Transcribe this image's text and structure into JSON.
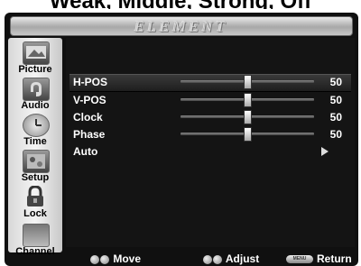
{
  "caption": "Weak, Middle, Strong, Off",
  "brand": "ELEMENT",
  "sidebar": {
    "items": [
      {
        "label": "Picture",
        "icon": "picture-icon",
        "selected": true
      },
      {
        "label": "Audio",
        "icon": "audio-icon",
        "selected": false
      },
      {
        "label": "Time",
        "icon": "time-icon",
        "selected": false
      },
      {
        "label": "Setup",
        "icon": "setup-icon",
        "selected": false
      },
      {
        "label": "Lock",
        "icon": "lock-icon",
        "selected": false
      },
      {
        "label": "Channel",
        "icon": "channel-icon",
        "selected": false
      }
    ]
  },
  "menu": {
    "rows": [
      {
        "label": "H-POS",
        "value": "50",
        "level": 0.5,
        "selected": true
      },
      {
        "label": "V-POS",
        "value": "50",
        "level": 0.5,
        "selected": false
      },
      {
        "label": "Clock",
        "value": "50",
        "level": 0.5,
        "selected": false
      },
      {
        "label": "Phase",
        "value": "50",
        "level": 0.5,
        "selected": false
      },
      {
        "label": "Auto",
        "value": "",
        "selected": false,
        "submenu": true
      }
    ]
  },
  "footer": {
    "move": "Move",
    "adjust": "Adjust",
    "menu_key": "MENU",
    "return": "Return"
  }
}
